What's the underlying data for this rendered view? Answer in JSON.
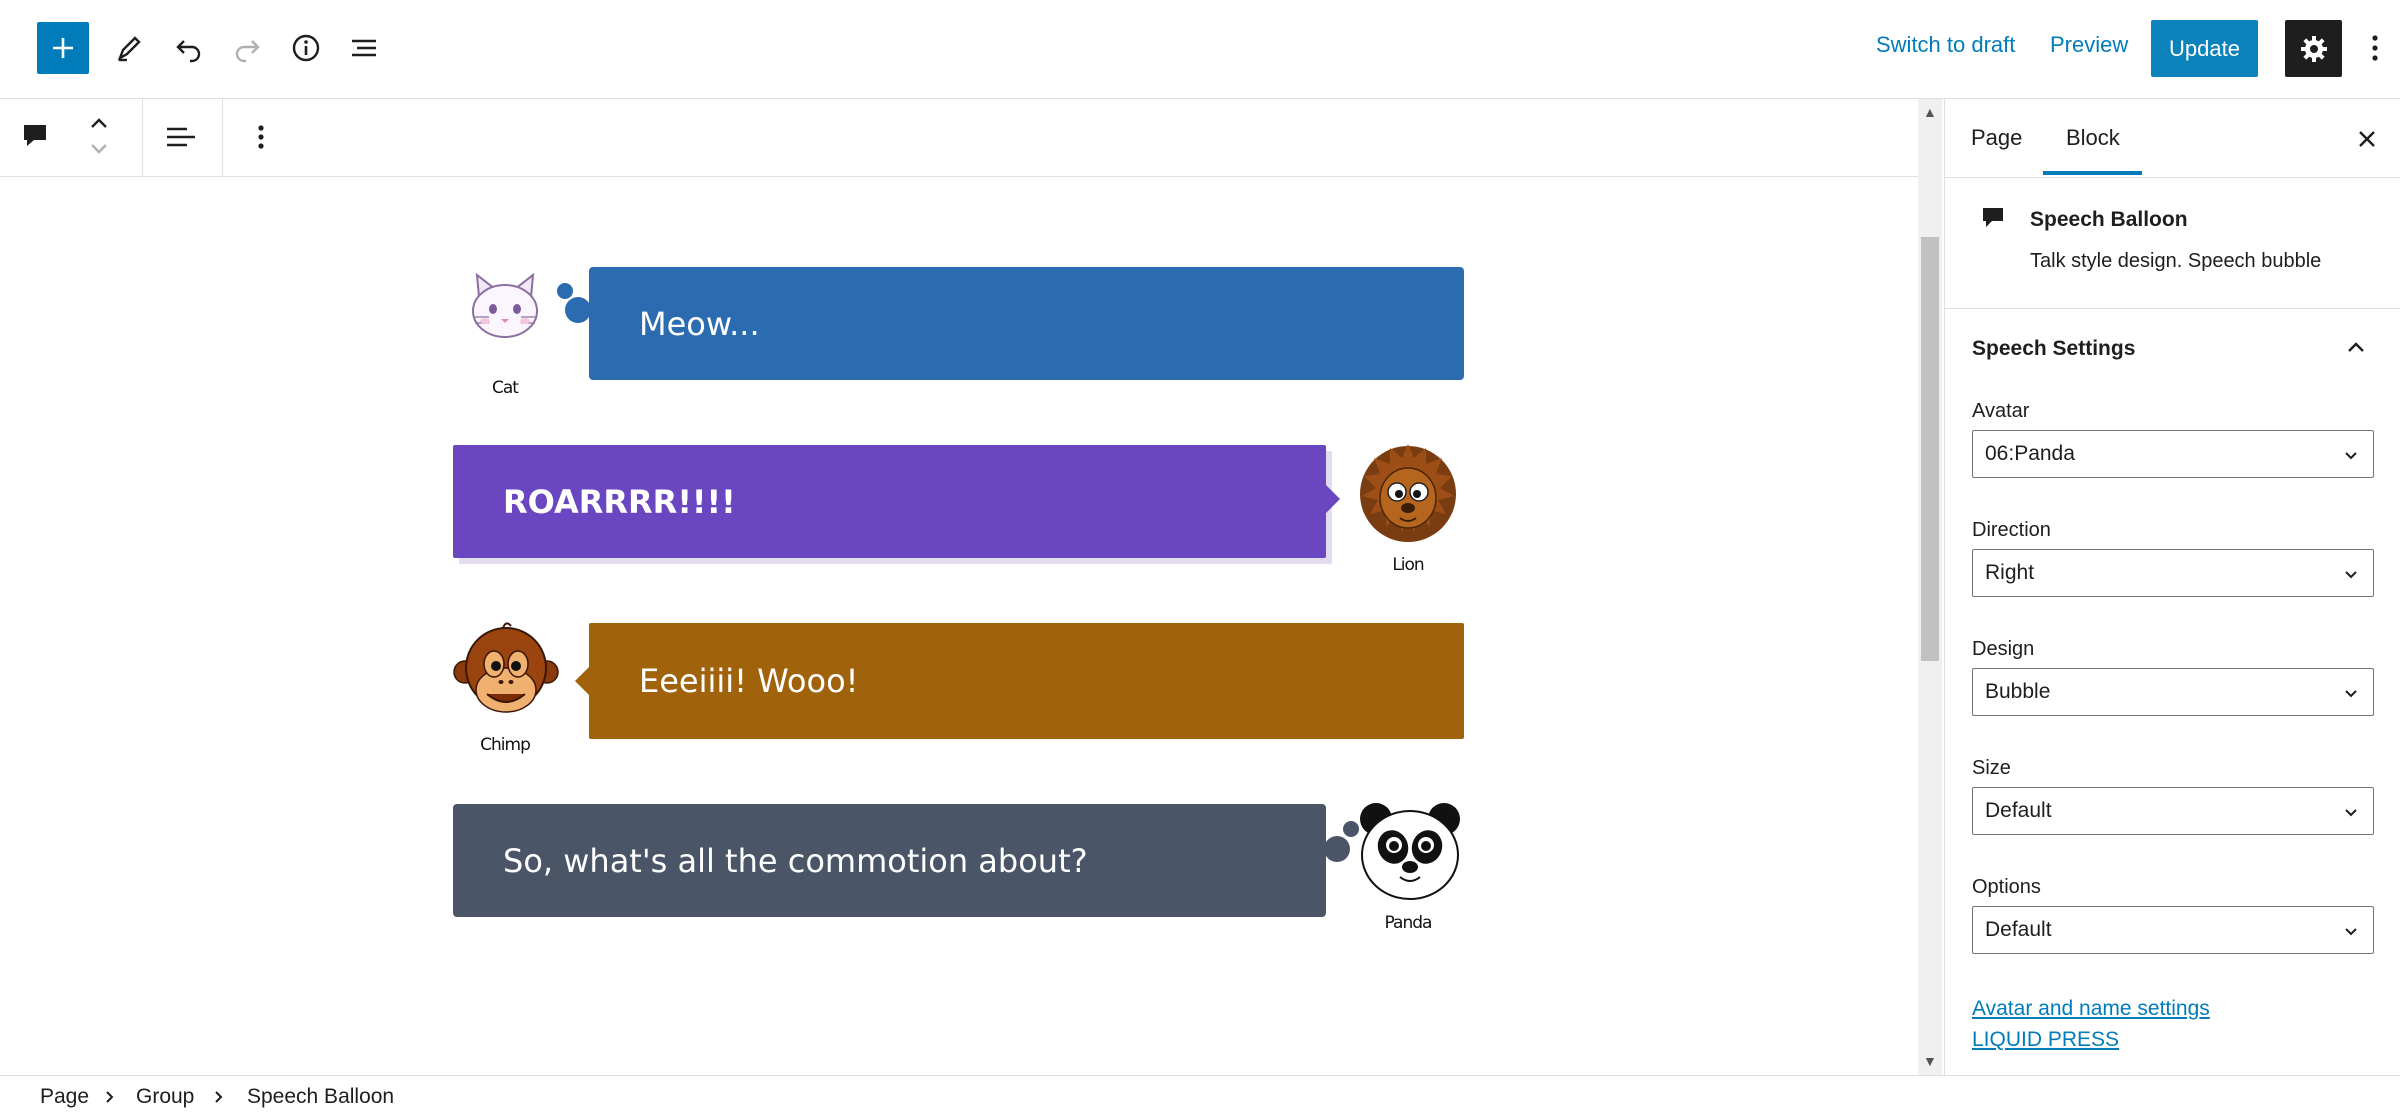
{
  "topbar": {
    "switch_to_draft": "Switch to draft",
    "preview": "Preview",
    "update": "Update"
  },
  "balloons": [
    {
      "text": "Meow...",
      "avatar": "Cat",
      "direction": "left",
      "color": "#2b6cb0",
      "style": "thought"
    },
    {
      "text": "ROARRRR!!!!",
      "avatar": "Lion",
      "direction": "right",
      "color": "#6b46c1",
      "style": "bubble"
    },
    {
      "text": "Eeeiiii!  Wooo!",
      "avatar": "Chimp",
      "direction": "left",
      "color": "#a0620a",
      "style": "bubble"
    },
    {
      "text": "So, what's all the commotion about?",
      "avatar": "Panda",
      "direction": "right",
      "color": "#4a5568",
      "style": "thought"
    }
  ],
  "sidebar": {
    "tabs": [
      "Page",
      "Block"
    ],
    "active_tab": "Block",
    "block": {
      "title": "Speech Balloon",
      "description": "Talk style design. Speech bubble"
    },
    "panel_title": "Speech Settings",
    "fields": [
      {
        "label": "Avatar",
        "value": "06:Panda"
      },
      {
        "label": "Direction",
        "value": "Right"
      },
      {
        "label": "Design",
        "value": "Bubble"
      },
      {
        "label": "Size",
        "value": "Default"
      },
      {
        "label": "Options",
        "value": "Default"
      }
    ],
    "links": [
      "Avatar and name settings",
      "LIQUID PRESS"
    ]
  },
  "breadcrumb": [
    "Page",
    "Group",
    "Speech Balloon"
  ],
  "colors": {
    "accent": "#007cba",
    "dark": "#1e1e1e"
  }
}
